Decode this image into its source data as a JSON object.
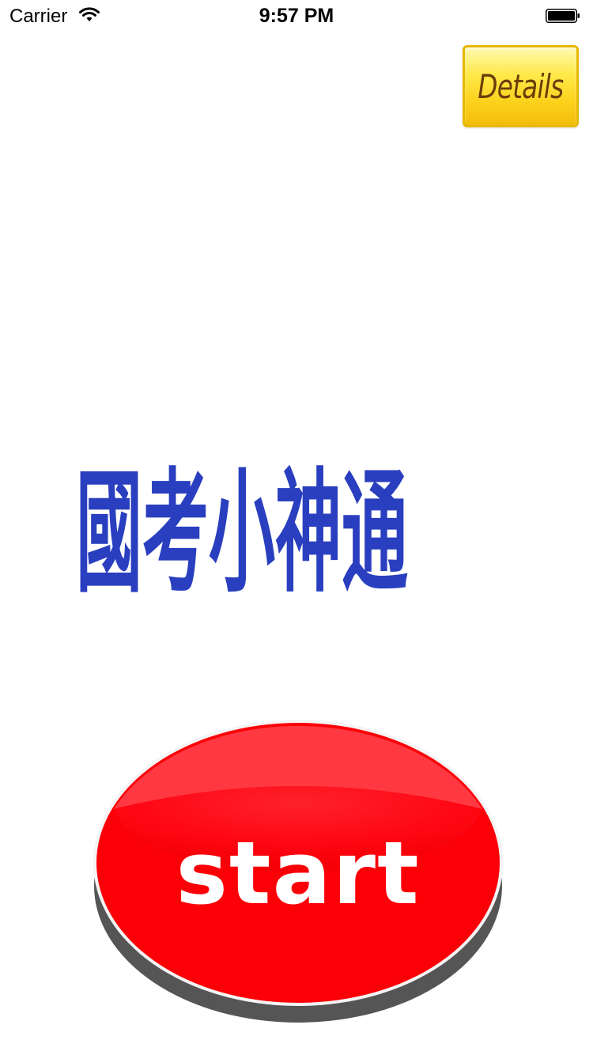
{
  "status_bar": {
    "carrier": "Carrier",
    "time": "9:57 PM",
    "wifi_icon": "wifi-icon",
    "battery_icon": "battery-icon"
  },
  "details_button": {
    "label": "Details",
    "colors": {
      "border": "#e6b800",
      "fill": "#ffe94a",
      "text": "#6a3d0a"
    }
  },
  "title": {
    "text": "國考小神通",
    "color": "#2a3fbf"
  },
  "start_button": {
    "label": "start",
    "colors": {
      "top": "#ff1a2a",
      "base": "#fc0008",
      "shadow": "#555555",
      "text": "#ffffff"
    }
  }
}
